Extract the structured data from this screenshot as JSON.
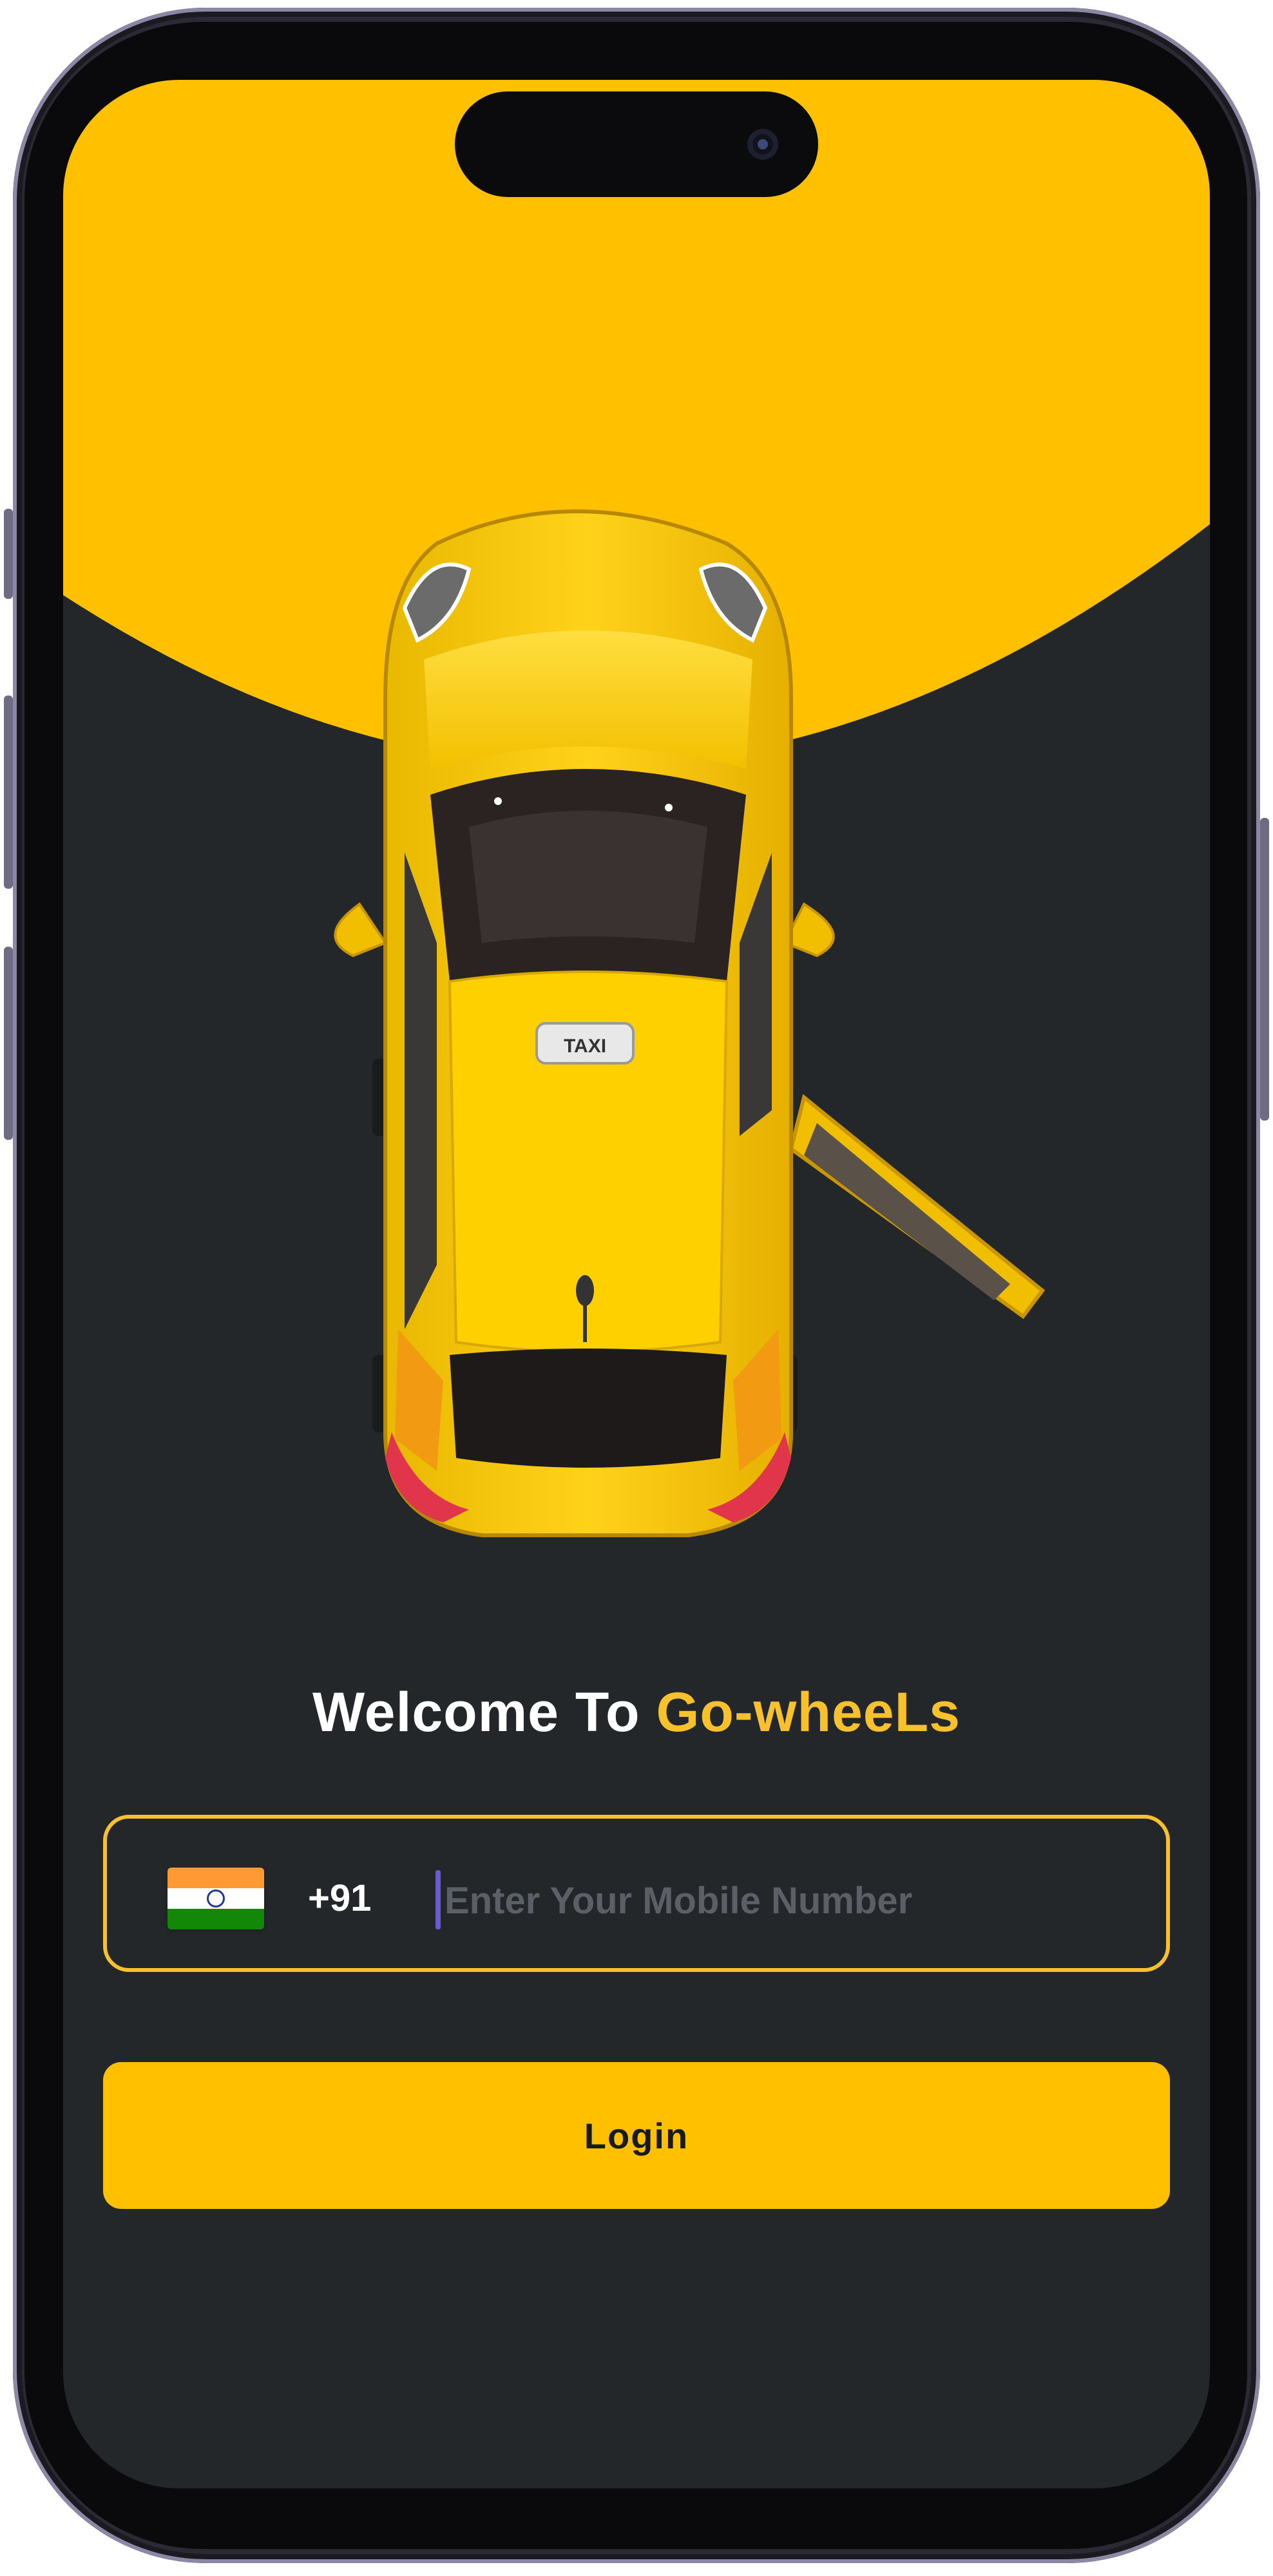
{
  "welcome": {
    "prefix": "Welcome To",
    "brand": "Go-wheeLs"
  },
  "phone_field": {
    "country_flag": "india-flag",
    "country_code": "+91",
    "placeholder": "Enter Your Mobile Number",
    "value": ""
  },
  "login_label": "Login",
  "hero": {
    "car_sign": "TAXI",
    "colors": {
      "yellow": "#ffc000",
      "dark": "#23272a"
    }
  }
}
